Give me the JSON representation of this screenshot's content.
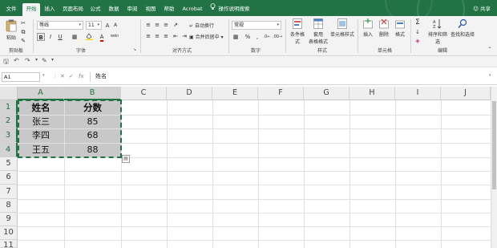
{
  "menu": {
    "tabs": [
      "文件",
      "开始",
      "插入",
      "页面布局",
      "公式",
      "数据",
      "审阅",
      "视图",
      "帮助",
      "Acrobat"
    ],
    "active_tab": "开始",
    "tell_me": "操作说明搜索",
    "share": "共享"
  },
  "ribbon": {
    "clipboard": {
      "paste": "粘贴",
      "label": "剪贴板"
    },
    "font": {
      "name": "等线",
      "size": "11",
      "label": "字体",
      "bold": "B",
      "italic": "I",
      "underline": "U",
      "grow": "A",
      "shrink": "A",
      "color_letter": "A",
      "wen": "wén"
    },
    "alignment": {
      "wrap": "自动换行",
      "merge": "合并后居中",
      "label": "对齐方式"
    },
    "number": {
      "format": "常规",
      "percent": "%",
      "comma": ",",
      "label": "数字"
    },
    "styles": {
      "conditional": "条件格式",
      "table": "套用",
      "table2": "表格格式",
      "cell_styles": "单元格样式",
      "label": "样式"
    },
    "cells": {
      "insert": "插入",
      "delete": "删除",
      "format": "格式",
      "label": "单元格"
    },
    "editing": {
      "sigma": "Σ",
      "sort": "排序和筛选",
      "find": "查找和选择",
      "label": "编辑"
    }
  },
  "formula_bar": {
    "name_box": "A1",
    "fx": "fx",
    "content": "姓名"
  },
  "columns": [
    "A",
    "B",
    "C",
    "D",
    "E",
    "F",
    "G",
    "H",
    "I",
    "J"
  ],
  "rows": [
    "1",
    "2",
    "3",
    "4",
    "5",
    "6",
    "7",
    "8",
    "9",
    "10",
    "11"
  ],
  "table": {
    "headers": [
      "姓名",
      "分数"
    ],
    "rows": [
      [
        "张三",
        "85"
      ],
      [
        "李四",
        "68"
      ],
      [
        "王五",
        "88"
      ]
    ]
  },
  "colors": {
    "accent": "#217346",
    "selection": "#c8c8c8",
    "ribbon_bg": "#f3f3f3"
  }
}
